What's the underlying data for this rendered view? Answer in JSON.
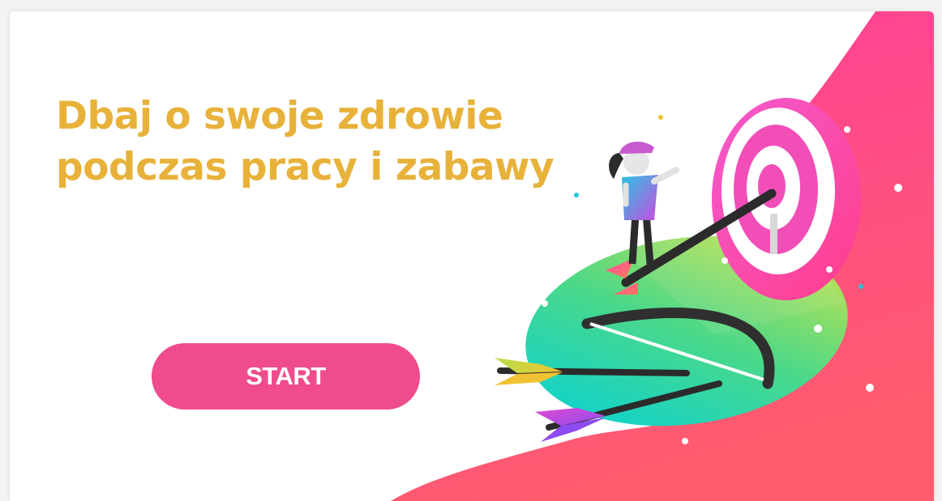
{
  "hero": {
    "title": "Dbaj o swoje zdrowie podczas pracy i zabawy",
    "start_label": "START"
  },
  "colors": {
    "title": "#e8b23a",
    "button": "#ef4b8d",
    "button_text": "#ffffff",
    "blob_pink": "#ff3d8f",
    "blob_coral": "#ff5a73"
  },
  "illustration": {
    "icon": "archery-target-icon"
  }
}
